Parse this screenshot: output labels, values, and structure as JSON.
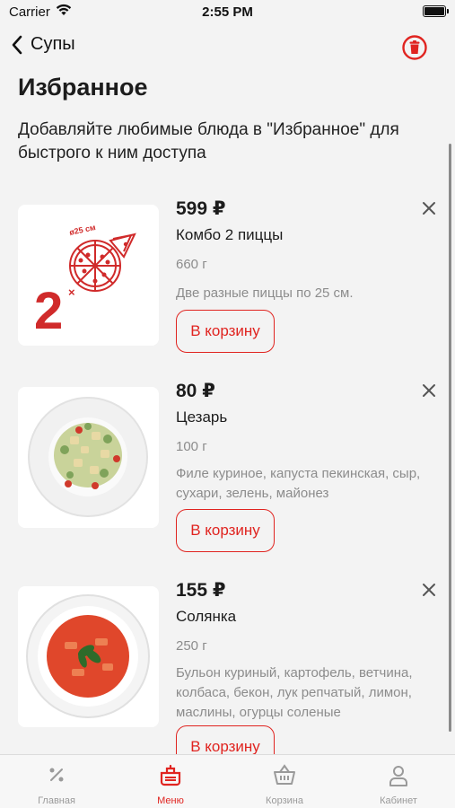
{
  "status_bar": {
    "carrier": "Carrier",
    "time": "2:55 PM"
  },
  "nav": {
    "back_label": "Супы"
  },
  "page": {
    "title": "Избранное",
    "subtitle": "Добавляйте любимые блюда в \"Избранное\" для быстрого к ним доступа"
  },
  "favorites": [
    {
      "price": "599 ₽",
      "name": "Комбо 2 пиццы",
      "weight": "660 г",
      "description": "Две разные пиццы по 25 см.",
      "cart_label": "В корзину",
      "image_icon": "pizza-combo-image",
      "image_badge": "2",
      "image_size_text": "ø25 см"
    },
    {
      "price": "80 ₽",
      "name": "Цезарь",
      "weight": "100 г",
      "description": "Филе куриное, капуста пекинская, сыр, сухари, зелень, майонез",
      "cart_label": "В корзину",
      "image_icon": "caesar-salad-image"
    },
    {
      "price": "155 ₽",
      "name": "Солянка",
      "weight": "250 г",
      "description": "Бульон куриный, картофель, ветчина, колбаса, бекон, лук репчатый, лимон, маслины, огурцы соленые",
      "cart_label": "В корзину",
      "image_icon": "solyanka-soup-image"
    }
  ],
  "tabs": [
    {
      "label": "Главная",
      "icon": "percent-icon",
      "active": false
    },
    {
      "label": "Меню",
      "icon": "menu-dish-icon",
      "active": true
    },
    {
      "label": "Корзина",
      "icon": "basket-icon",
      "active": false
    },
    {
      "label": "Кабинет",
      "icon": "user-icon",
      "active": false
    }
  ],
  "colors": {
    "accent": "#e02420",
    "background": "#f3f3f3",
    "muted_text": "#8c8c8c",
    "inactive_tab": "#9a9a9a"
  }
}
